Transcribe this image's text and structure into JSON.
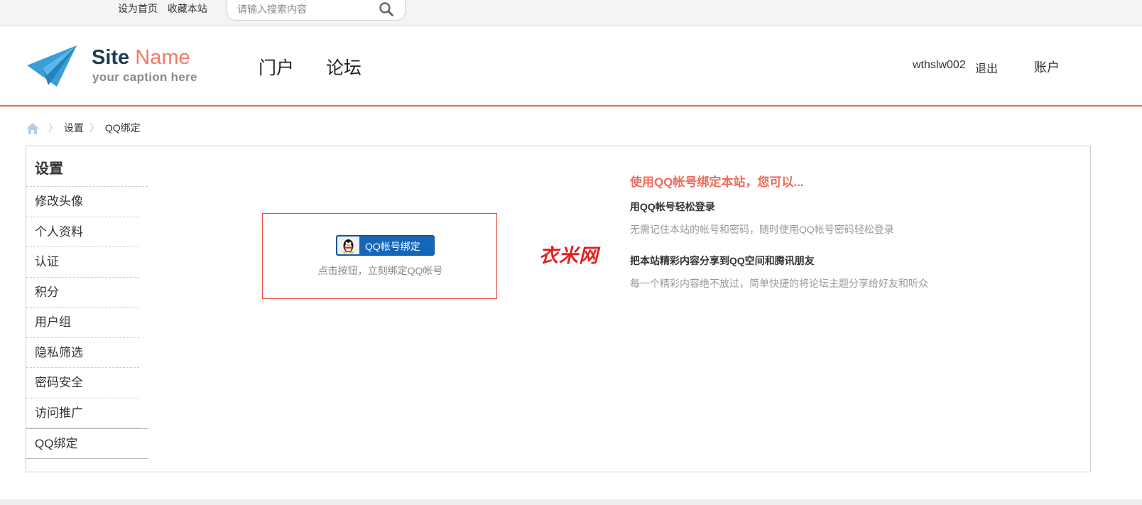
{
  "topbar": {
    "links": [
      "设为首页",
      "收藏本站"
    ],
    "search_placeholder": "请输入搜索内容"
  },
  "header": {
    "site_name_bold": "Site",
    "site_name_light": " Name",
    "caption": "your caption here",
    "nav": [
      "门户",
      "论坛"
    ],
    "username": "wthslw002",
    "logout": "退出",
    "account": "账户"
  },
  "breadcrumb": [
    "设置",
    "QQ绑定"
  ],
  "sidebar": {
    "title": "设置",
    "items": [
      {
        "label": "修改头像"
      },
      {
        "label": "个人资料"
      },
      {
        "label": "认证"
      },
      {
        "label": "积分"
      },
      {
        "label": "用户组"
      },
      {
        "label": "隐私筛选"
      },
      {
        "label": "密码安全"
      },
      {
        "label": "访问推广"
      },
      {
        "label": "QQ绑定",
        "active": true
      }
    ]
  },
  "bind": {
    "button_label": "QQ帐号绑定",
    "hint": "点击按钮，立刻绑定QQ帐号"
  },
  "watermark": "衣米网",
  "benefits": {
    "heading": "使用QQ帐号绑定本站，您可以...",
    "items": [
      {
        "title": "用QQ帐号轻松登录",
        "desc": "无需记住本站的帐号和密码，随时使用QQ帐号密码轻松登录"
      },
      {
        "title": "把本站精彩内容分享到QQ空间和腾讯朋友",
        "desc": "每一个精彩内容绝不放过，简单快捷的将论坛主题分享给好友和听众"
      }
    ]
  },
  "colors": {
    "accent": "#f06b5a",
    "qq_button": "#1566b8",
    "border": "#cdcdcd"
  }
}
